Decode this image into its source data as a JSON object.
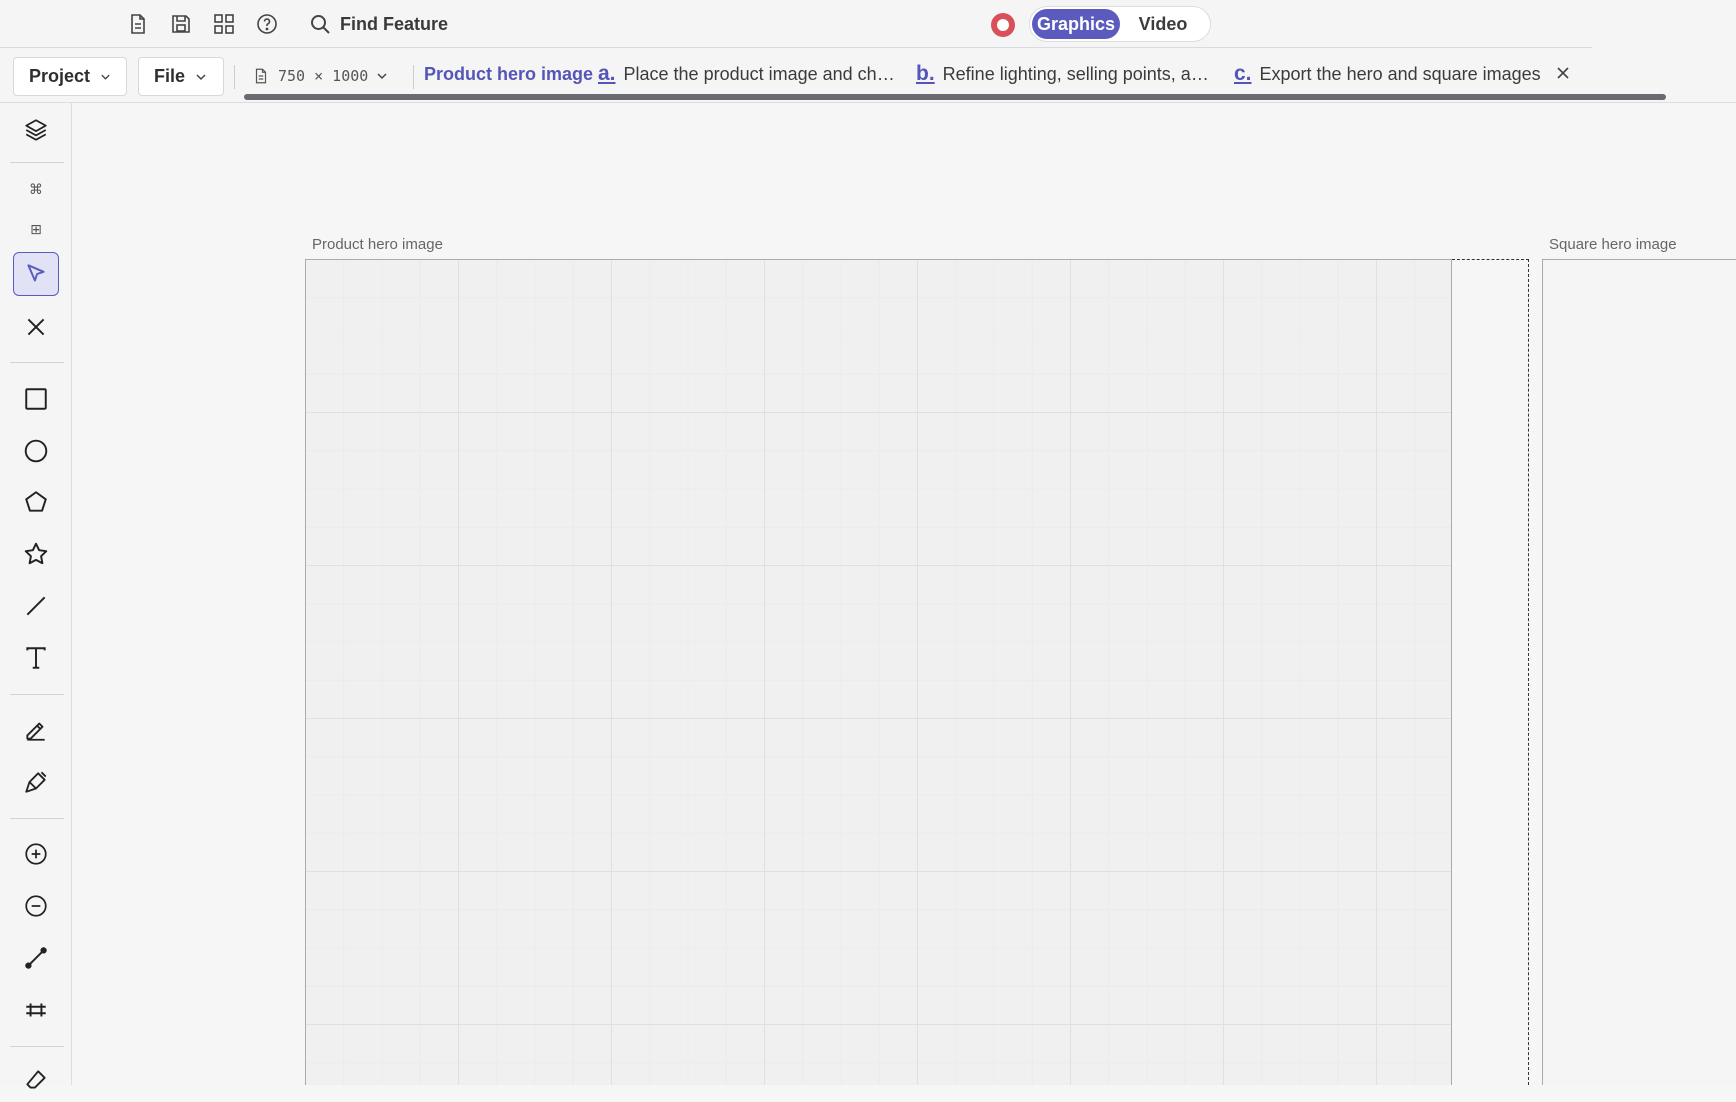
{
  "topbar": {
    "icons": [
      "new-document-icon",
      "save-icon",
      "grid-apps-icon",
      "help-icon"
    ],
    "find_feature_label": "Find Feature",
    "modes": {
      "graphics_label": "Graphics",
      "video_label": "Video",
      "active": "Graphics"
    },
    "accent_color": "#5b5bbd",
    "record_color": "#d9505b"
  },
  "subbar": {
    "project_label": "Project",
    "file_label": "File",
    "canvas_size": "750 × 1000",
    "project_title": "Product hero image",
    "steps": [
      {
        "letter": "a.",
        "text": "Place the product image and che···"
      },
      {
        "letter": "b.",
        "text": "Refine lighting, selling points, an···"
      },
      {
        "letter": "c.",
        "text": "Export the hero and square images"
      }
    ]
  },
  "leftbar": {
    "tools": [
      "layers-icon",
      "command-icon",
      "grid-icon",
      "select-arrow-icon",
      "close-icon",
      "rectangle-icon",
      "ellipse-icon",
      "polygon-icon",
      "star-icon",
      "line-icon",
      "text-icon",
      "pen-icon",
      "brush-icon",
      "zoom-in-icon",
      "zoom-out-icon",
      "connector-icon",
      "align-icon",
      "eraser-icon"
    ],
    "selected_tool": "select-arrow-icon",
    "command_glyph": "⌘",
    "grid_glyph": "⊞"
  },
  "canvas": {
    "artboards": [
      {
        "label": "Product hero image"
      },
      {
        "label": "Square hero image"
      }
    ]
  }
}
